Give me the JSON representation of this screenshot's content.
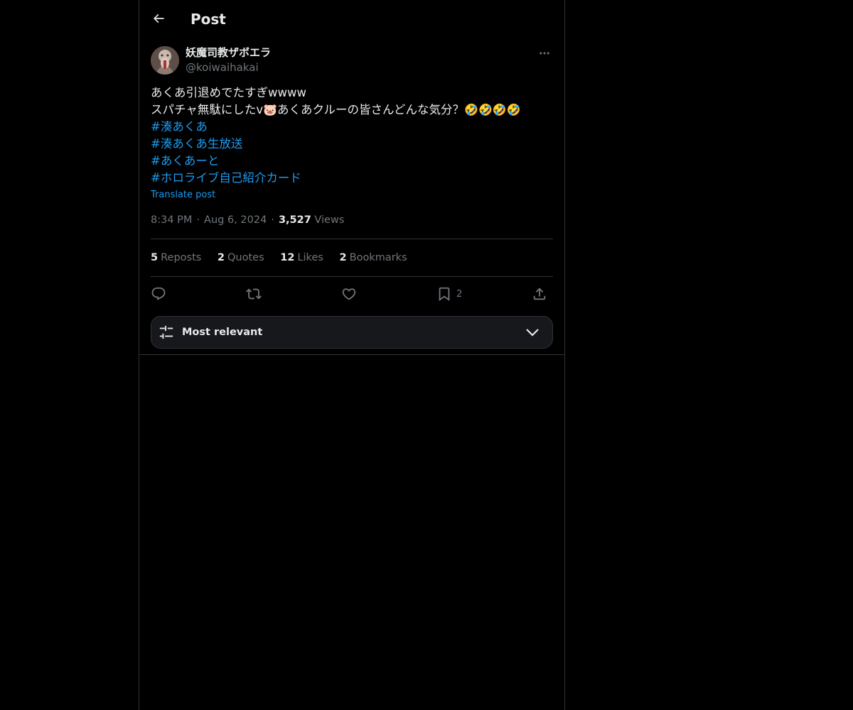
{
  "header": {
    "title": "Post",
    "back_icon": "arrow-left-icon"
  },
  "author": {
    "display_name": "妖魔司教ザボエラ",
    "handle": "@koiwaihakai",
    "more_icon": "more-horizontal-icon"
  },
  "tweet": {
    "line1": "あくあ引退めでたすぎwwww",
    "line2_before": "スパチャ無駄にしたv",
    "line2_emoji": "🐷",
    "line2_after": "あくあクルーの皆さんどんな気分？",
    "line2_trailing_emoji": "🤣🤣🤣🤣",
    "hashtags": [
      "#湊あくあ",
      "#湊あくあ生放送",
      "#あくあーと",
      "#ホロライブ自己紹介カード"
    ],
    "translate_label": "Translate post"
  },
  "meta": {
    "time": "8:34 PM",
    "date": "Aug 6, 2024",
    "views_count": "3,527",
    "views_label": "Views",
    "separator": "·"
  },
  "stats": {
    "reposts": {
      "count": "5",
      "label": "Reposts"
    },
    "quotes": {
      "count": "2",
      "label": "Quotes"
    },
    "likes": {
      "count": "12",
      "label": "Likes"
    },
    "bookmarks": {
      "count": "2",
      "label": "Bookmarks"
    }
  },
  "actions": {
    "reply_icon": "reply-icon",
    "repost_icon": "repost-icon",
    "like_icon": "heart-icon",
    "bookmark_icon": "bookmark-icon",
    "bookmark_count": "2",
    "share_icon": "share-icon"
  },
  "sort": {
    "label": "Most relevant",
    "icon": "sliders-icon",
    "chevron": "chevron-down-icon"
  },
  "colors": {
    "background": "#000000",
    "text": "#e7e9ea",
    "muted": "#71767b",
    "link": "#1d9bf0",
    "border": "#2f3336"
  }
}
